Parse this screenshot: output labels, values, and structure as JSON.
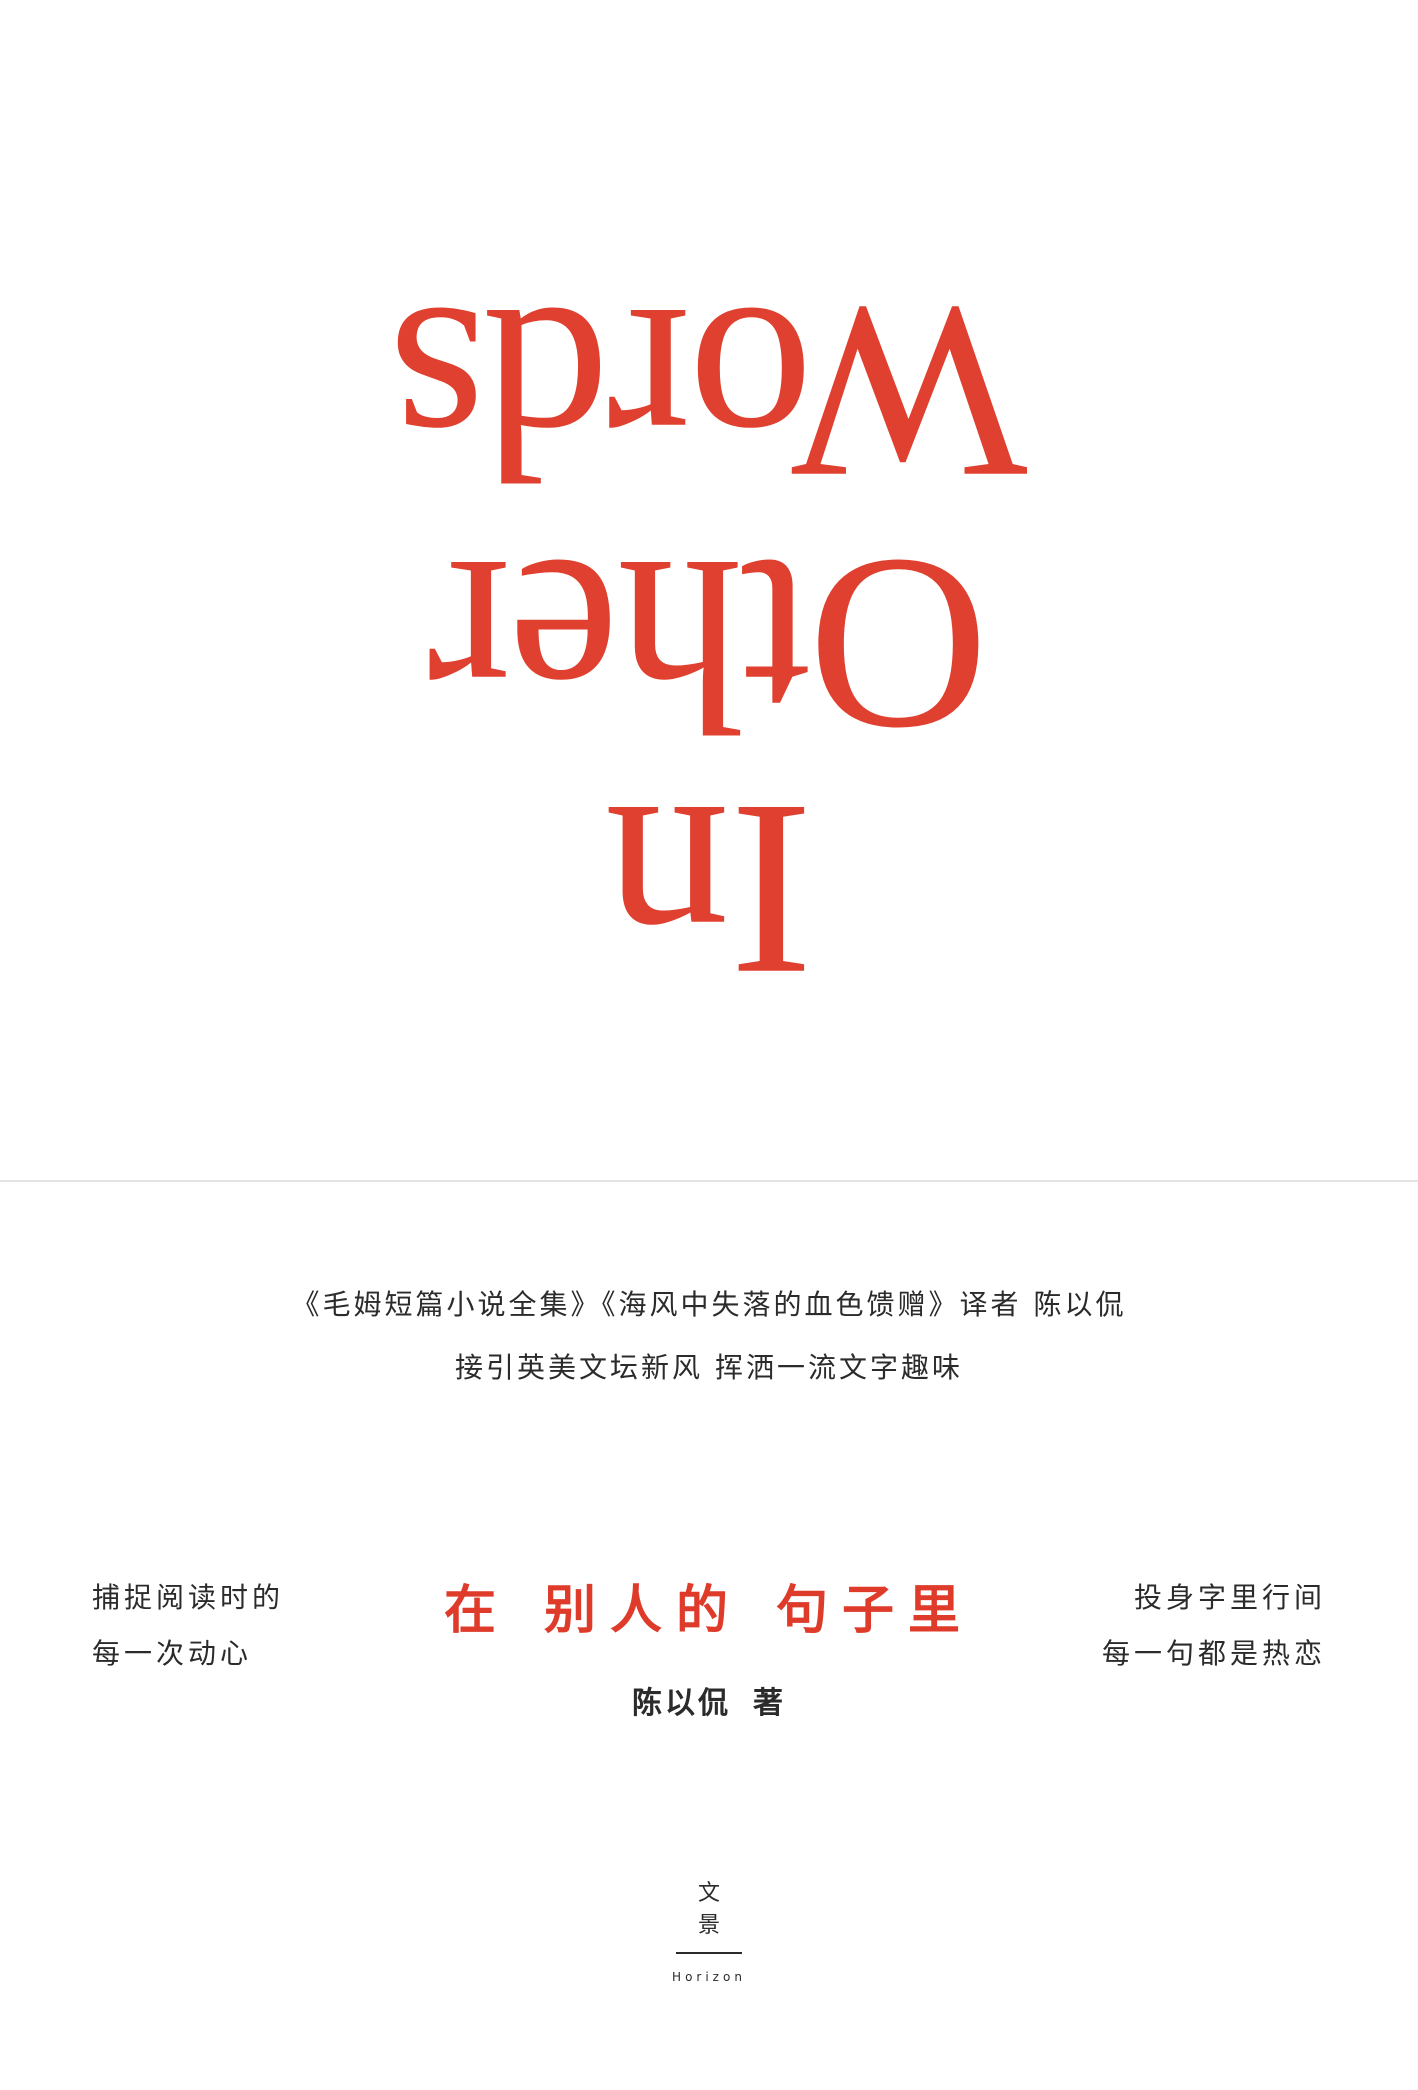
{
  "cover": {
    "title_en": {
      "line_1": "In",
      "line_2": "Other",
      "line_3": "Words"
    },
    "tagline": {
      "line_1": "《毛姆短篇小说全集》《海风中失落的血色馈赠》译者 陈以侃",
      "line_2": "接引英美文坛新风 挥洒一流文字趣味"
    },
    "left_blurb": {
      "line_1": "捕捉阅读时的",
      "line_2": "每一次动心"
    },
    "right_blurb": {
      "line_1": "投身字里行间",
      "line_2": "每一句都是热恋"
    },
    "title_cn": {
      "part_1": "在",
      "part_2": "别人的",
      "part_3": "句子里"
    },
    "author": {
      "name": "陈以侃",
      "role": "著"
    },
    "publisher": {
      "char_1": "文",
      "char_2": "景",
      "en": "Horizon"
    },
    "colors": {
      "accent": "#e0402f",
      "text": "#2b2b2b",
      "divider": "#e4e4e4",
      "background": "#ffffff"
    }
  }
}
